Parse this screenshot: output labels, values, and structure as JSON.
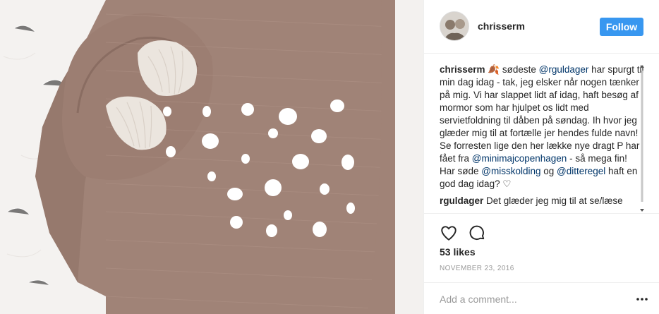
{
  "post": {
    "image_alt": "",
    "colors": {
      "fabric": "#a08377",
      "dots": "#ffffff",
      "fur": "#f3f1ef",
      "ear_inner": "#e9e3dc"
    }
  },
  "header": {
    "username": "chrisserm",
    "follow_label": "Follow",
    "follow_color": "#3897f0"
  },
  "caption": {
    "author": "chrisserm",
    "emoji": "🍂",
    "text_1": " sødeste ",
    "mention_1": "@rguldager",
    "text_2": " har spurgt til min dag idag - tak, jeg elsker når nogen tænker på mig. Vi har slappet lidt af idag, haft besøg af mormor som har hjulpet os lidt med servietfoldning til dåben på søndag. Ih hvor jeg glæder mig til at fortælle jer hendes fulde navn! Se forresten lige den her lække nye dragt P har fået fra ",
    "mention_2": "@minimajcopenhagen",
    "text_3": " - så mega fin! Har søde ",
    "mention_3": "@misskolding",
    "text_4": " og ",
    "mention_4": "@ditteregel",
    "text_5": " haft en god dag idag? ♡"
  },
  "reply": {
    "author": "rguldager",
    "text": " Det glæder jeg mig til at se/læse"
  },
  "actions": {
    "like_icon": "heart-outline",
    "comment_icon": "speech-bubble-outline",
    "likes": "53 likes",
    "date": "NOVEMBER 23, 2016"
  },
  "add_comment": {
    "placeholder": "Add a comment...",
    "more_icon": "three-dots"
  }
}
